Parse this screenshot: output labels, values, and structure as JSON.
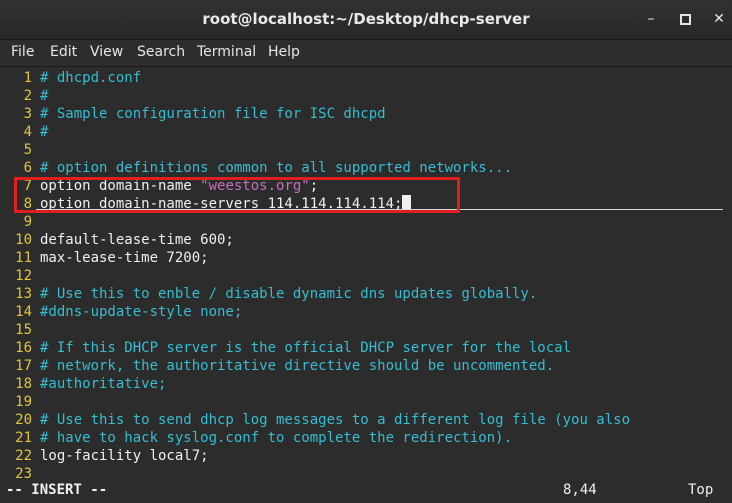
{
  "window": {
    "title": "root@localhost:~/Desktop/dhcp-server",
    "minimize_glyph": "–",
    "close_glyph": "✕"
  },
  "menu": {
    "items": [
      "File",
      "Edit",
      "View",
      "Search",
      "Terminal",
      "Help"
    ]
  },
  "editor": {
    "lines": [
      {
        "num": "1",
        "text": "# dhcpd.conf",
        "kind": "comment"
      },
      {
        "num": "2",
        "text": "#",
        "kind": "comment"
      },
      {
        "num": "3",
        "text": "# Sample configuration file for ISC dhcpd",
        "kind": "comment"
      },
      {
        "num": "4",
        "text": "#",
        "kind": "comment"
      },
      {
        "num": "5",
        "text": "",
        "kind": "plain"
      },
      {
        "num": "6",
        "text": "# option definitions common to all supported networks...",
        "kind": "comment"
      },
      {
        "num": "7",
        "text_before": "option domain-name ",
        "string": "\"weestos.org\"",
        "text_after": ";",
        "kind": "mixed"
      },
      {
        "num": "8",
        "text": "option domain-name-servers 114.114.114.114;",
        "kind": "plain"
      },
      {
        "num": "9",
        "text": "",
        "kind": "plain"
      },
      {
        "num": "10",
        "text": "default-lease-time 600;",
        "kind": "plain"
      },
      {
        "num": "11",
        "text": "max-lease-time 7200;",
        "kind": "plain"
      },
      {
        "num": "12",
        "text": "",
        "kind": "plain"
      },
      {
        "num": "13",
        "text": "# Use this to enble / disable dynamic dns updates globally.",
        "kind": "comment"
      },
      {
        "num": "14",
        "text": "#ddns-update-style none;",
        "kind": "comment"
      },
      {
        "num": "15",
        "text": "",
        "kind": "plain"
      },
      {
        "num": "16",
        "text": "# If this DHCP server is the official DHCP server for the local",
        "kind": "comment"
      },
      {
        "num": "17",
        "text": "# network, the authoritative directive should be uncommented.",
        "kind": "comment"
      },
      {
        "num": "18",
        "text": "#authoritative;",
        "kind": "comment"
      },
      {
        "num": "19",
        "text": "",
        "kind": "plain"
      },
      {
        "num": "20",
        "text": "# Use this to send dhcp log messages to a different log file (you also",
        "kind": "comment"
      },
      {
        "num": "21",
        "text": "# have to hack syslog.conf to complete the redirection).",
        "kind": "comment"
      },
      {
        "num": "22",
        "text": "log-facility local7;",
        "kind": "plain"
      },
      {
        "num": "23",
        "text": "",
        "kind": "plain"
      }
    ]
  },
  "status": {
    "mode": "-- INSERT --",
    "position": "8,44",
    "scroll": "Top"
  },
  "colors": {
    "line_numbers": "#e0c63a",
    "comment": "#35bdd1",
    "string": "#c56fbd",
    "highlight_box": "#e02020"
  }
}
